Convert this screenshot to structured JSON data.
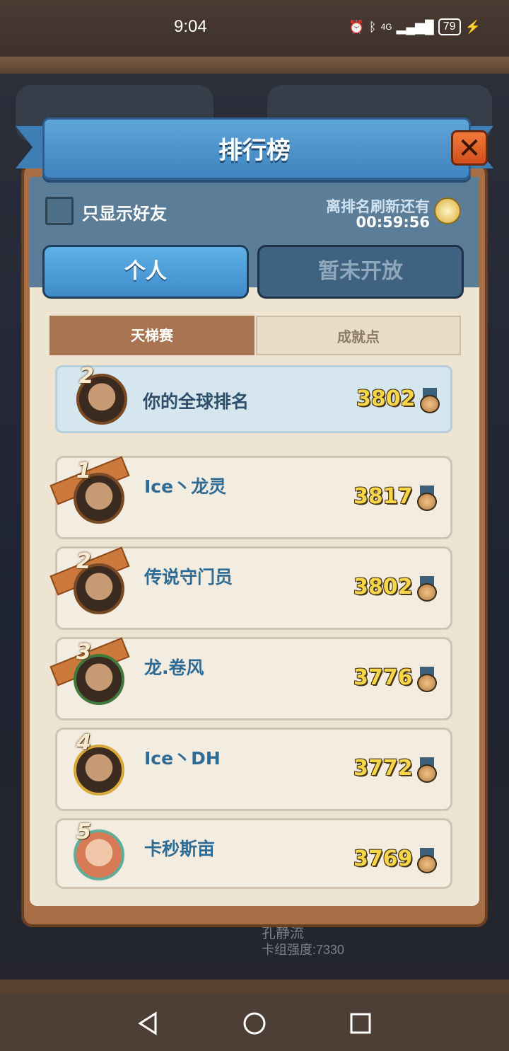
{
  "status_bar": {
    "time": "9:04",
    "network": "4G",
    "battery": "79"
  },
  "background": {
    "deck_name": "孔静流",
    "deck_power": "卡组强度:7330"
  },
  "panel": {
    "title": "排行榜",
    "close_icon": "close-icon",
    "friends_only_label": "只显示好友",
    "refresh_label": "离排名刷新还有",
    "refresh_time": "00:59:56",
    "tabs": [
      {
        "label": "个人",
        "active": true
      },
      {
        "label": "暂未开放",
        "active": false
      }
    ],
    "sub_tabs": [
      {
        "label": "天梯赛",
        "active": true
      },
      {
        "label": "成就点",
        "active": false
      }
    ],
    "my_rank": {
      "rank": "2",
      "label": "你的全球排名",
      "score": "3802"
    },
    "rows": [
      {
        "rank": "1",
        "name": "Ice丶龙灵",
        "score": "3817"
      },
      {
        "rank": "2",
        "name": "传说守门员",
        "score": "3802"
      },
      {
        "rank": "3",
        "name": "龙.卷风",
        "score": "3776"
      },
      {
        "rank": "4",
        "name": "Ice丶DH",
        "score": "3772"
      },
      {
        "rank": "5",
        "name": "卡秒斯亩",
        "score": "3769"
      }
    ]
  },
  "colors": {
    "accent_blue": "#3f8bc9",
    "score_gold": "#f7d74a",
    "panel_wood": "#a76d45"
  }
}
